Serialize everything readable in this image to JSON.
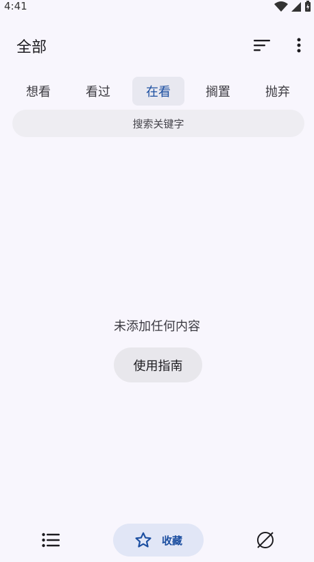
{
  "status_bar": {
    "time": "4:41",
    "icons": [
      "wifi-icon",
      "signal-icon",
      "battery-icon"
    ]
  },
  "app_bar": {
    "title": "全部",
    "actions": [
      "sort-icon",
      "more-vert-icon"
    ]
  },
  "tabs": [
    {
      "label": "想看",
      "active": false
    },
    {
      "label": "看过",
      "active": false
    },
    {
      "label": "在看",
      "active": true
    },
    {
      "label": "搁置",
      "active": false
    },
    {
      "label": "抛弃",
      "active": false
    }
  ],
  "search": {
    "placeholder": "搜索关键字"
  },
  "empty_state": {
    "message": "未添加任何内容",
    "button_label": "使用指南"
  },
  "bottom_nav": {
    "items": [
      {
        "icon": "list-icon",
        "label": "",
        "active": false
      },
      {
        "icon": "star-icon",
        "label": "收藏",
        "active": true
      },
      {
        "icon": "planet-icon",
        "label": "",
        "active": false
      }
    ]
  },
  "colors": {
    "background": "#f8f6fd",
    "accent": "#1b4ea0",
    "active_tab_bg": "#e8e8f0",
    "nav_active_bg": "#e1e6f6"
  }
}
